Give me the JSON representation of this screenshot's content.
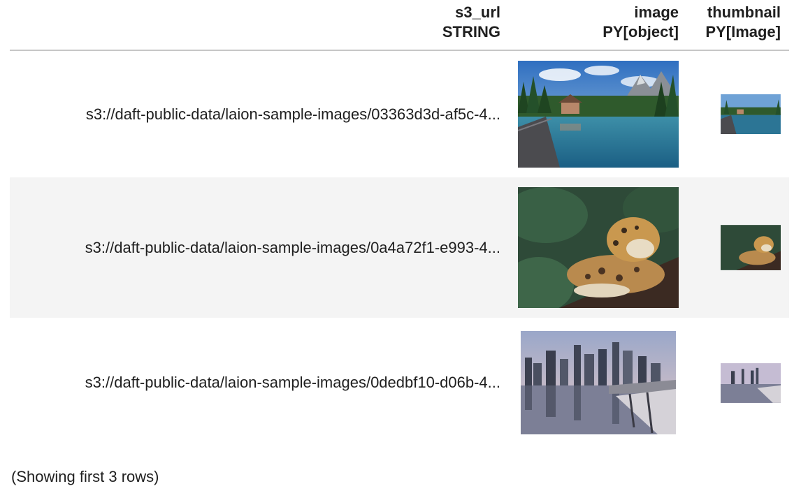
{
  "table": {
    "columns": [
      {
        "name": "s3_url",
        "type": "STRING"
      },
      {
        "name": "image",
        "type": "PY[object]"
      },
      {
        "name": "thumbnail",
        "type": "PY[Image]"
      }
    ],
    "rows": [
      {
        "s3_url": "s3://daft-public-data/laion-sample-images/03363d3d-af5c-4...",
        "image_alt": "mountain-lake-cabin-image",
        "thumbnail_alt": "mountain-lake-cabin-thumbnail"
      },
      {
        "s3_url": "s3://daft-public-data/laion-sample-images/0a4a72f1-e993-4...",
        "image_alt": "jaguar-painting-image",
        "thumbnail_alt": "jaguar-painting-thumbnail"
      },
      {
        "s3_url": "s3://daft-public-data/laion-sample-images/0dedbf10-d06b-4...",
        "image_alt": "city-skyline-reflection-image",
        "thumbnail_alt": "city-skyline-reflection-thumbnail"
      }
    ]
  },
  "footer": {
    "caption": "(Showing first 3 rows)"
  }
}
